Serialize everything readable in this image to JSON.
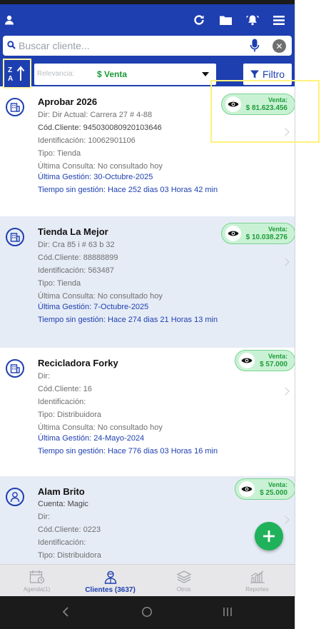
{
  "search": {
    "placeholder": "Buscar cliente..."
  },
  "filters": {
    "relevance_label": "Relevancia:",
    "relevance_value": "$ Venta",
    "filter_label": "Filtro"
  },
  "clients": [
    {
      "name": "Aprobar 2026",
      "sale_label": "Venta:",
      "sale_value": "$ 81.623.456",
      "address": "Dir: Dir Actual: Carrera 27 # 4-88",
      "code": "Cód.Cliente: 945030080920103646",
      "id": "Identificación: 10062901106",
      "type": "Tipo: Tienda",
      "last_query": "Última Consulta: No consultado hoy",
      "last_action": "Última Gestión: 30-Octubre-2025",
      "time_without": "Tiempo sin gestión: Hace 252 dias 03 Horas 42 min"
    },
    {
      "name": "Tienda La Mejor",
      "sale_label": "Venta:",
      "sale_value": "$ 10.038.276",
      "address": "Dir: Cra 85 i # 63 b 32",
      "code": "Cód.Cliente: 88888899",
      "id": "Identificación: 563487",
      "type": "Tipo: Tienda",
      "last_query": "Última Consulta: No consultado hoy",
      "last_action": "Última Gestión: 7-Octubre-2025",
      "time_without": "Tiempo sin gestión: Hace 274 dias 21 Horas 13 min"
    },
    {
      "name": "Recicladora Forky",
      "sale_label": "Venta:",
      "sale_value": "$ 57.000",
      "address": "Dir:",
      "code": "Cód.Cliente: 16",
      "id": "Identificación:",
      "type": "Tipo: Distribuidora",
      "last_query": "Última Consulta: No consultado hoy",
      "last_action": "Última Gestión: 24-Mayo-2024",
      "time_without": "Tiempo sin gestión: Hace 776 dias 03 Horas 16 min"
    },
    {
      "name": "Alam Brito",
      "sale_label": "Venta:",
      "sale_value": "$ 25.000",
      "account": "Cuenta: Magic",
      "address": "Dir:",
      "code": "Cód.Cliente: 0223",
      "id": "Identificación:",
      "type": "Tipo: Distribuidora"
    }
  ],
  "tabs": [
    {
      "label": "Agenda(1)",
      "icon": "calendar-icon"
    },
    {
      "label": "Clientes (3637)",
      "icon": "clients-icon"
    },
    {
      "label": "Otros",
      "icon": "layers-icon"
    },
    {
      "label": "Reportes",
      "icon": "reports-icon"
    }
  ],
  "colors": {
    "primary": "#1e3fb0",
    "sale_green": "#1f9c3b",
    "sale_bg": "#c9f2d4",
    "fab_green": "#1fb25a",
    "highlight": "#fff27a"
  }
}
